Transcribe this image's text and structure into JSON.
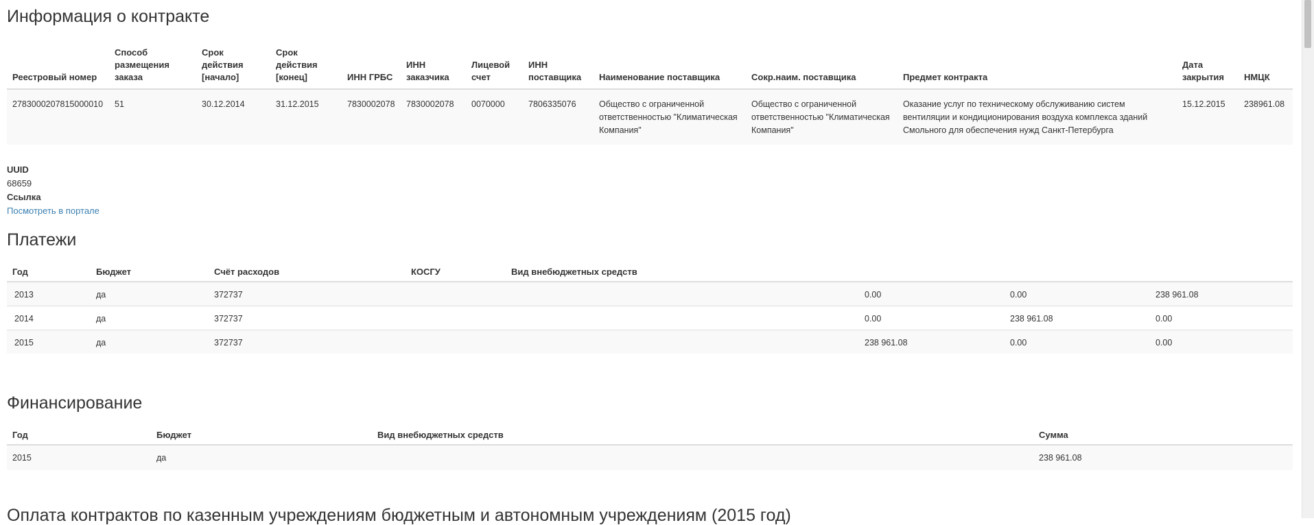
{
  "contract": {
    "title": "Информация о контракте",
    "headers": {
      "reg_num": "Реестровый номер",
      "method": "Способ размещения заказа",
      "start": "Срок действия [начало]",
      "end": "Срок действия [конец]",
      "inn_grbs": "ИНН ГРБС",
      "inn_customer": "ИНН заказчика",
      "account": "Лицевой счет",
      "inn_supplier": "ИНН поставщика",
      "supplier_name": "Наименование поставщика",
      "supplier_short": "Сокр.наим. поставщика",
      "subject": "Предмет контракта",
      "close_date": "Дата закрытия",
      "nmck": "НМЦК"
    },
    "row": {
      "reg_num": "2783000207815000010",
      "method": "51",
      "start": "30.12.2014",
      "end": "31.12.2015",
      "inn_grbs": "7830002078",
      "inn_customer": "7830002078",
      "account": "0070000",
      "inn_supplier": "7806335076",
      "supplier_name": "Общество с ограниченной ответственностью \"Климатическая Компания\"",
      "supplier_short": "Общество с ограниченной ответственностью \"Климатическая Компания\"",
      "subject": "Оказание услуг по техническому обслуживанию систем вентиляции и кондиционирования воздуха комплекса зданий Смольного для обеспечения нужд Санкт-Петербурга",
      "close_date": "15.12.2015",
      "nmck": "238961.08"
    }
  },
  "meta": {
    "uuid_label": "UUID",
    "uuid_value": "68659",
    "link_label": "Ссылка",
    "link_text": "Посмотреть в портале"
  },
  "payments": {
    "title": "Платежи",
    "headers": {
      "year": "Год",
      "budget": "Бюджет",
      "account": "Счёт расходов",
      "kosgu": "КОСГУ",
      "extra": "Вид внебюджетных средств"
    },
    "rows": [
      {
        "year": "2013",
        "budget": "да",
        "account": "372737",
        "v1": "0.00",
        "v2": "0.00",
        "v3": "238 961.08"
      },
      {
        "year": "2014",
        "budget": "да",
        "account": "372737",
        "v1": "0.00",
        "v2": "238 961.08",
        "v3": "0.00"
      },
      {
        "year": "2015",
        "budget": "да",
        "account": "372737",
        "v1": "238 961.08",
        "v2": "0.00",
        "v3": "0.00"
      }
    ]
  },
  "funding": {
    "title": "Финансирование",
    "headers": {
      "year": "Год",
      "budget": "Бюджет",
      "extra": "Вид внебюджетных средств",
      "sum": "Сумма"
    },
    "rows": [
      {
        "year": "2015",
        "budget": "да",
        "extra": "",
        "sum": "238 961.08"
      }
    ]
  },
  "next_section": {
    "title": "Оплата контрактов по казенным учреждениям бюджетным и автономным учреждениям (2015 год)"
  }
}
